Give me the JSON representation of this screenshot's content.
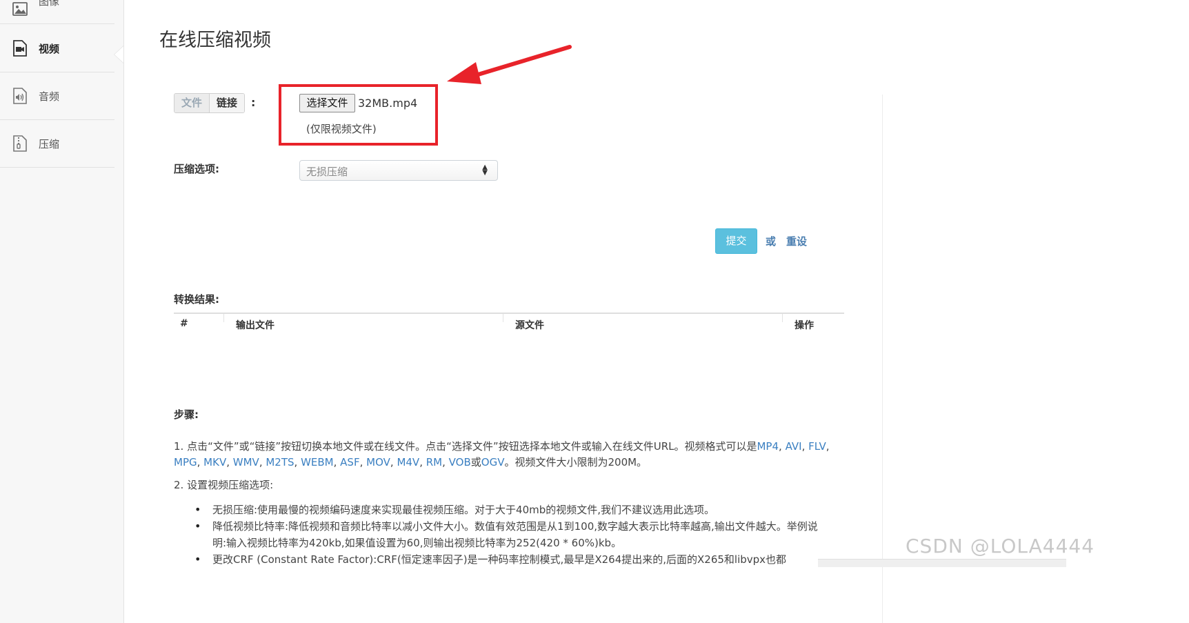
{
  "sidebar": {
    "items": [
      {
        "label": "图像",
        "icon": "image-icon"
      },
      {
        "label": "视频",
        "icon": "video-icon"
      },
      {
        "label": "音频",
        "icon": "audio-file-icon"
      },
      {
        "label": "压缩",
        "icon": "zip-file-icon"
      }
    ]
  },
  "main": {
    "title": "在线压缩视频",
    "source_toggle": {
      "file": "文件",
      "link": "链接",
      "colon": ":"
    },
    "file_input": {
      "button": "选择文件",
      "filename": "32MB.mp4",
      "hint": "(仅限视频文件)"
    },
    "compression": {
      "label": "压缩选项:",
      "selected": "无损压缩"
    },
    "actions": {
      "submit": "提交",
      "or": "或",
      "reset": "重设"
    },
    "result": {
      "label": "转换结果:",
      "columns": [
        "#",
        "输出文件",
        "源文件",
        "操作"
      ]
    },
    "steps": {
      "label": "步骤:",
      "step1_prefix": "1. 点击“文件”或“链接”按钮切换本地文件或在线文件。点击“选择文件”按钮选择本地文件或输入在线文件URL。视频格式可以是",
      "formats": [
        "MP4",
        "AVI",
        "FLV",
        "MPG",
        "MKV",
        "WMV",
        "M2TS",
        "WEBM",
        "ASF",
        "MOV",
        "M4V",
        "RM",
        "VOB",
        "OGV"
      ],
      "sep": ",",
      "or_word": "或",
      "step1_suffix": "。视频文件大小限制为200M。",
      "step2": "2. 设置视频压缩选项:",
      "bullets": [
        "无损压缩:使用最慢的视频编码速度来实现最佳视频压缩。对于大于40mb的视频文件,我们不建议选用此选项。",
        "降低视频比特率:降低视频和音频比特率以减小文件大小。数值有效范围是从1到100,数字越大表示比特率越高,输出文件越大。举例说明:输入视频比特率为420kb,如果值设置为60,则输出视频比特率为252(420 * 60%)kb。",
        "更改CRF (Constant Rate Factor):CRF(恒定速率因子)是一种码率控制模式,最早是X264提出来的,后面的X265和libvpx也都"
      ]
    }
  },
  "watermark": "CSDN @LOLA4444",
  "colors": {
    "accent": "#5bc0de",
    "link": "#3a7fc1",
    "highlight": "#e8232a"
  }
}
